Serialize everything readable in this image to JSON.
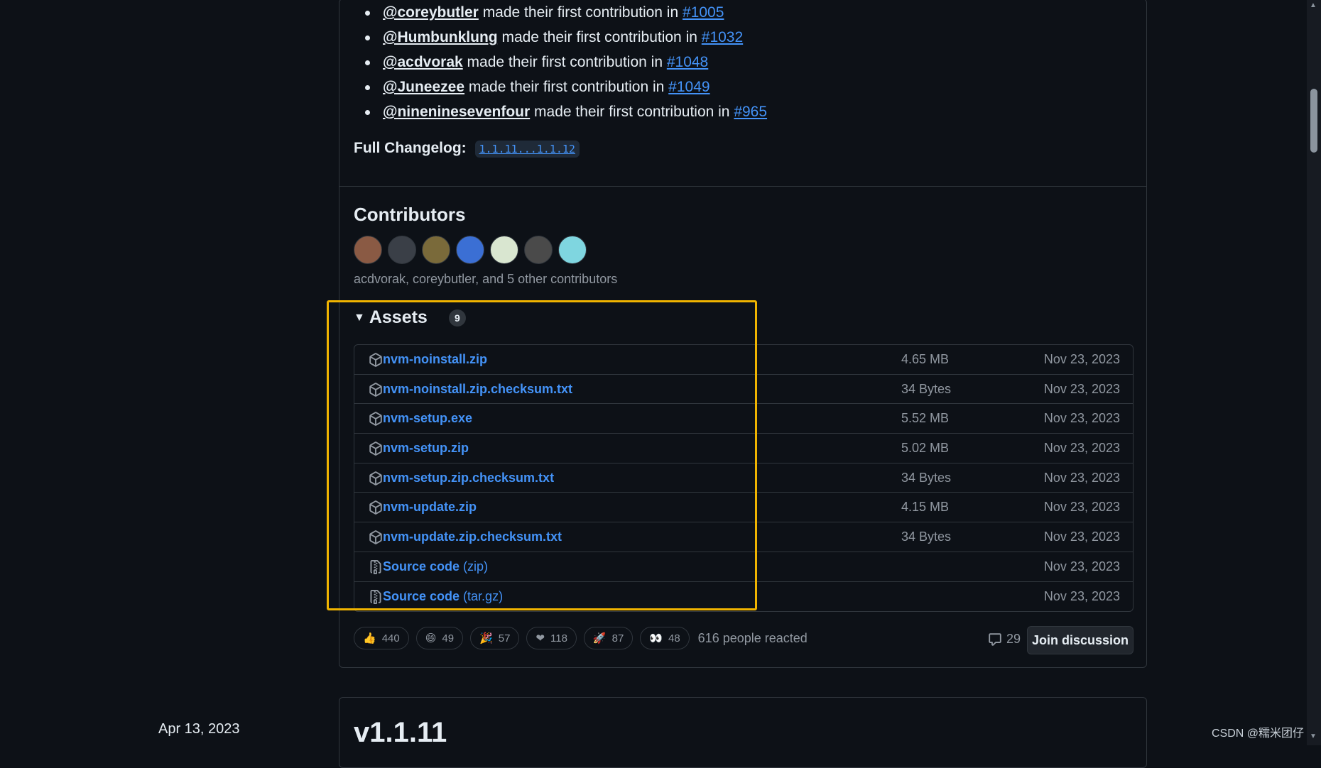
{
  "new_contributors": [
    {
      "user": "@coreybutler",
      "text": " made their first contribution in ",
      "pr": "#1005"
    },
    {
      "user": "@Humbunklung",
      "text": " made their first contribution in ",
      "pr": "#1032"
    },
    {
      "user": "@acdvorak",
      "text": " made their first contribution in ",
      "pr": "#1048"
    },
    {
      "user": "@Juneezee",
      "text": " made their first contribution in ",
      "pr": "#1049"
    },
    {
      "user": "@nineninesevenfour",
      "text": " made their first contribution in ",
      "pr": "#965"
    }
  ],
  "changelog": {
    "label": "Full Changelog:",
    "compare": "1.1.11...1.1.12"
  },
  "contributors": {
    "title": "Contributors",
    "summary": "acdvorak, coreybutler, and 5 other contributors",
    "avatar_colors": [
      "#8a5a44",
      "#3a3f47",
      "#7a6a3a",
      "#3b6fd4",
      "#d9e6d0",
      "#4a4a4a",
      "#7fd6e0"
    ]
  },
  "assets": {
    "title": "Assets",
    "count": "9",
    "rows": [
      {
        "name": "nvm-noinstall.zip",
        "suffix": "",
        "size": "4.65 MB",
        "date": "Nov 23, 2023",
        "icon": "package-icon"
      },
      {
        "name": "nvm-noinstall.zip.checksum.txt",
        "suffix": "",
        "size": "34 Bytes",
        "date": "Nov 23, 2023",
        "icon": "package-icon"
      },
      {
        "name": "nvm-setup.exe",
        "suffix": "",
        "size": "5.52 MB",
        "date": "Nov 23, 2023",
        "icon": "package-icon"
      },
      {
        "name": "nvm-setup.zip",
        "suffix": "",
        "size": "5.02 MB",
        "date": "Nov 23, 2023",
        "icon": "package-icon"
      },
      {
        "name": "nvm-setup.zip.checksum.txt",
        "suffix": "",
        "size": "34 Bytes",
        "date": "Nov 23, 2023",
        "icon": "package-icon"
      },
      {
        "name": "nvm-update.zip",
        "suffix": "",
        "size": "4.15 MB",
        "date": "Nov 23, 2023",
        "icon": "package-icon"
      },
      {
        "name": "nvm-update.zip.checksum.txt",
        "suffix": "",
        "size": "34 Bytes",
        "date": "Nov 23, 2023",
        "icon": "package-icon"
      },
      {
        "name": "Source code",
        "suffix": " (zip)",
        "size": "",
        "date": "Nov 23, 2023",
        "icon": "file-zip-icon"
      },
      {
        "name": "Source code",
        "suffix": " (tar.gz)",
        "size": "",
        "date": "Nov 23, 2023",
        "icon": "file-zip-icon"
      }
    ]
  },
  "reactions": [
    {
      "emoji": "👍",
      "count": "440",
      "name": "thumbs-up-icon"
    },
    {
      "emoji": "😄",
      "count": "49",
      "name": "laugh-icon"
    },
    {
      "emoji": "🎉",
      "count": "57",
      "name": "hooray-icon"
    },
    {
      "emoji": "❤",
      "count": "118",
      "name": "heart-icon"
    },
    {
      "emoji": "🚀",
      "count": "87",
      "name": "rocket-icon"
    },
    {
      "emoji": "👀",
      "count": "48",
      "name": "eyes-icon"
    }
  ],
  "reacted_text": "616 people reacted",
  "comments_count": "29",
  "join_label": "Join discussion",
  "next_release": {
    "title": "v1.1.11",
    "date": "Apr 13, 2023"
  },
  "watermark": "CSDN @糯米团仔"
}
